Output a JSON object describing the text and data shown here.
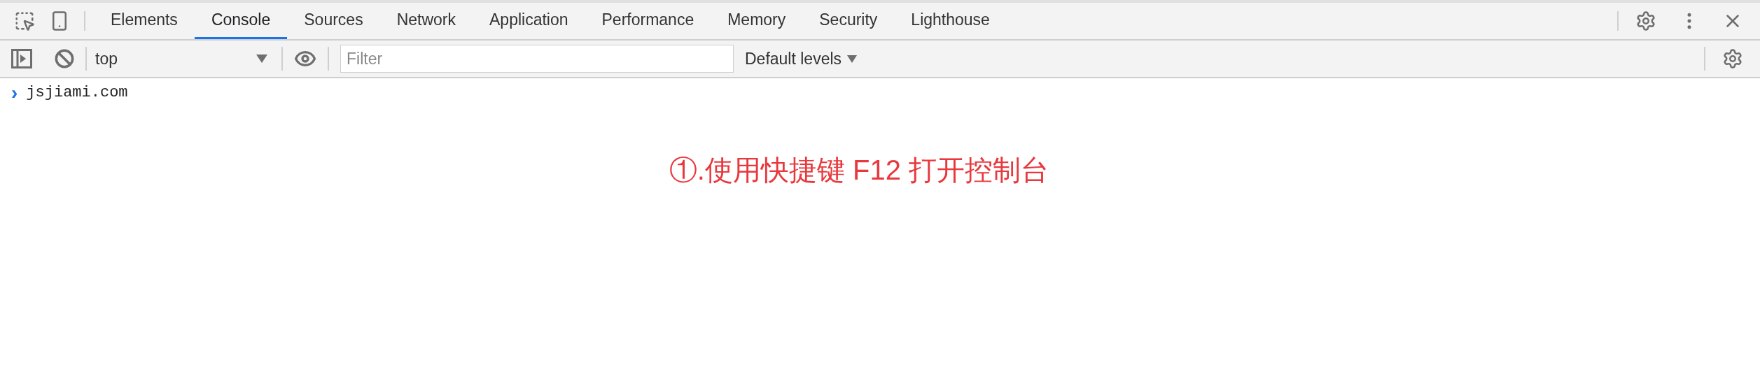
{
  "tabs": [
    {
      "label": "Elements",
      "selected": false
    },
    {
      "label": "Console",
      "selected": true
    },
    {
      "label": "Sources",
      "selected": false
    },
    {
      "label": "Network",
      "selected": false
    },
    {
      "label": "Application",
      "selected": false
    },
    {
      "label": "Performance",
      "selected": false
    },
    {
      "label": "Memory",
      "selected": false
    },
    {
      "label": "Security",
      "selected": false
    },
    {
      "label": "Lighthouse",
      "selected": false
    }
  ],
  "console_toolbar": {
    "context": "top",
    "filter_placeholder": "Filter",
    "levels": "Default levels"
  },
  "console_lines": [
    {
      "prompt": "›",
      "text": "jsjiami.com"
    }
  ],
  "annotation": "①.使用快捷键 F12 打开控制台"
}
